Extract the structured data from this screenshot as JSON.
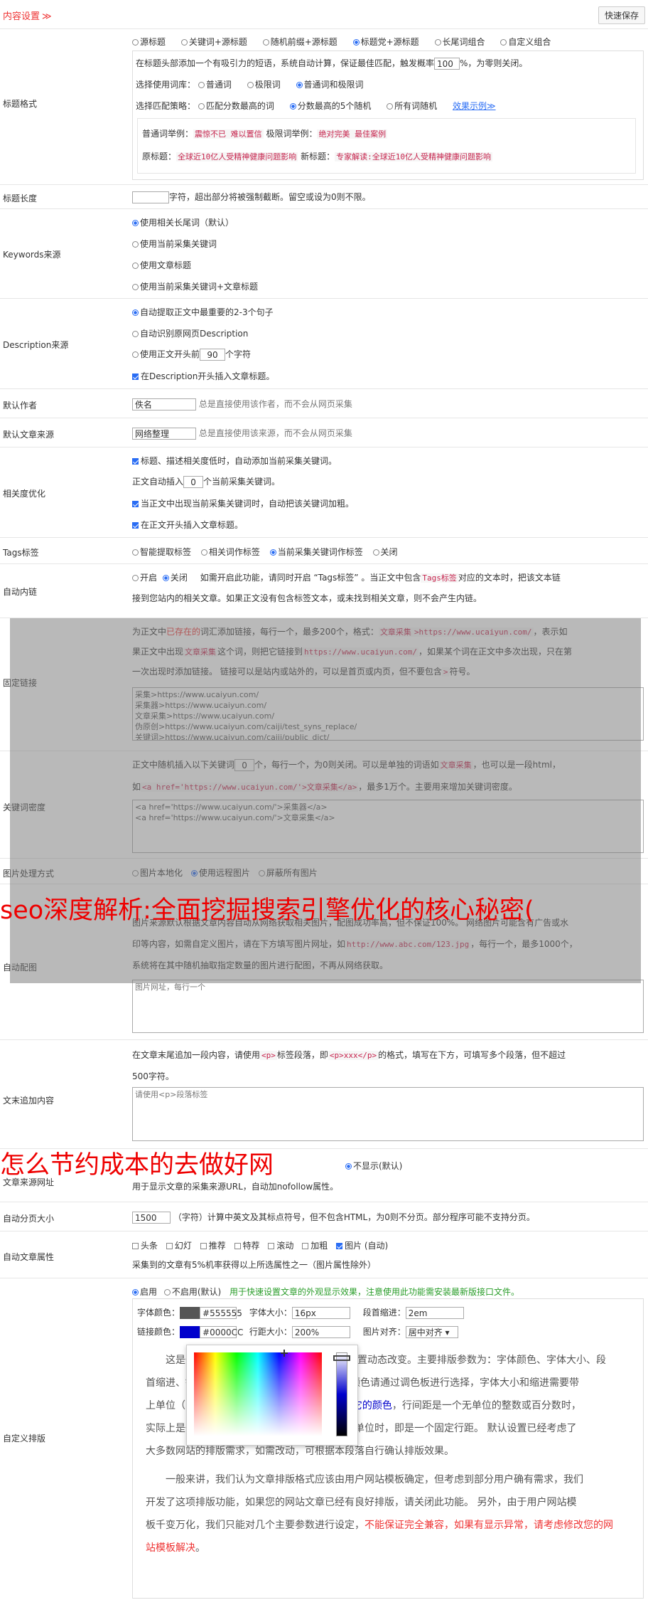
{
  "header": {
    "title": "内容设置",
    "chev": "≫",
    "save_label": "快速保存"
  },
  "rows": {
    "title_format": {
      "label": "标题格式",
      "modes": [
        "源标题",
        "关键词+源标题",
        "随机前缀+源标题",
        "标题党+源标题",
        "长尾词组合",
        "自定义组合"
      ],
      "desc_pre": "在标题头部添加一个有吸引力的短语，系统自动计算，保证最佳匹配，触发概率",
      "prob": "100",
      "desc_post": "%，为零则关闭。",
      "lib_label": "选择使用词库：",
      "libs": [
        "普通词",
        "极限词",
        "普通词和极限词"
      ],
      "strat_label": "选择匹配策略：",
      "strats": [
        "匹配分数最高的词",
        "分数最高的5个随机",
        "所有词随机"
      ],
      "effect_link": "效果示例≫",
      "ex_normal_label": "普通词举例：",
      "ex_normal": "震惊不已 难以置信",
      "ex_limit_label": "极限词举例：",
      "ex_limit": "绝对完美 最佳案例",
      "ex_src_label": "原标题：",
      "ex_src": "全球近10亿人受精神健康问题影响",
      "ex_new_label": "新标题：",
      "ex_new": "专家解读:全球近10亿人受精神健康问题影响"
    },
    "title_len": {
      "label": "标题长度",
      "suffix": "字符，超出部分将被强制截断。留空或设为0则不限。"
    },
    "keywords": {
      "label": "Keywords来源",
      "opts": [
        "使用相关长尾词（默认）",
        "使用当前采集关键词",
        "使用文章标题",
        "使用当前采集关键词+文章标题"
      ]
    },
    "description": {
      "label": "Description来源",
      "opt1": "自动提取正文中最重要的2-3个句子",
      "opt2": "自动识别原网页Description",
      "opt3_pre": "使用正文开头前",
      "opt3_val": "90",
      "opt3_post": "个字符",
      "chk": "在Description开头插入文章标题。"
    },
    "author": {
      "label": "默认作者",
      "value": "佚名",
      "hint": "总是直接使用该作者，而不会从网页采集"
    },
    "source": {
      "label": "默认文章来源",
      "value": "网络整理",
      "hint": "总是直接使用该来源，而不会从网页采集"
    },
    "relevance": {
      "label": "相关度优化",
      "c1": "标题、描述相关度低时，自动添加当前采集关键词。",
      "c2_pre": "正文自动插入",
      "c2_val": "0",
      "c2_post": "个当前采集关键词。",
      "c3": "当正文中出现当前采集关键词时，自动把该关键词加粗。",
      "c4": "在正文开头插入文章标题。"
    },
    "tags": {
      "label": "Tags标签",
      "opts": [
        "智能提取标签",
        "相关词作标签",
        "当前采集关键词作标签",
        "关闭"
      ]
    },
    "autolink": {
      "label": "自动内链",
      "on": "开启",
      "off": "关闭",
      "l1_pre": "如需开启此功能，请同时开启 “Tags标签” 。当正文中包含",
      "l1_code": "Tags标签",
      "l1_post": "对应的文本时，把该文本链",
      "l2": "接到您站内的相关文章。如果正文没有包含标签文本，或未找到相关文章，则不会产生内链。"
    },
    "fixlink": {
      "label": "固定链接",
      "l1_a": "为正文中",
      "l1_b": "已存在的",
      "l1_c": "词汇添加链接，每行一个，最多200个，格式：",
      "l1_code1": "文章采集",
      "l1_code2": ">https://www.ucaiyun.com/",
      "l1_d": "，表示如",
      "l2_a": "果正文中出现",
      "l2_code1": "文章采集",
      "l2_b": "这个词，则把它链接到",
      "l2_code2": "https://www.ucaiyun.com/",
      "l2_c": "，如果某个词在正文中多次出现，只在第",
      "l3": "一次出现时添加链接。 链接可以是站内或站外的，可以是首页或内页，但不要包含",
      "l3_code": ">",
      "l3_post": "符号。",
      "box": [
        "采集>https://www.ucaiyun.com/",
        "采集器>https://www.ucaiyun.com/",
        "文章采集>https://www.ucaiyun.com/",
        "伪原创>https://www.ucaiyun.com/caiji/test_syns_replace/",
        "关键词>https://www.ucaiyun.com/caiji/public_dict/"
      ]
    },
    "density": {
      "label": "关键词密度",
      "l1_pre": "正文中随机插入以下关键词",
      "l1_val": "0",
      "l1_mid": "个，每行一个，为0则关闭。可以是单独的词语如",
      "l1_code": "文章采集",
      "l1_post": "，也可以是一段html，",
      "l2_pre": "如",
      "l2_code": "<a href='https://www.ucaiyun.com/'>文章采集</a>",
      "l2_post": "，最多1万个。主要用来增加关键词密度。",
      "box": [
        "<a href='https://www.ucaiyun.com/'>采集器</a>",
        "<a href='https://www.ucaiyun.com/'>文章采集</a>"
      ]
    },
    "image": {
      "label": "图片处理方式",
      "opts": [
        "图片本地化",
        "使用远程图片",
        "屏蔽所有图片"
      ]
    },
    "autoimg": {
      "label": "自动配图",
      "l1": "图片来源默认根据文章内容自动从网络获取相关图片，配图成功率高，但不保证100%。 网络图片可能含有广告或水",
      "l2_pre": "印等内容，如需自定义图片，请在下方填写图片网址，如",
      "l2_code": "http://www.abc.com/123.jpg",
      "l2_post": "，每行一个，最多1000个，",
      "l3": "系统将在其中随机抽取指定数量的图片进行配图，不再从网络获取。",
      "placeholder": "图片网址，每行一个"
    },
    "tail": {
      "label": "文末追加内容",
      "l1_pre": "在文章末尾追加一段内容，请使用",
      "l1_code1": "<p>",
      "l1_mid": "标签段落，即",
      "l1_code2": "<p>xxx</p>",
      "l1_post": "的格式，填写在下方，可填写多个段落，但不超过",
      "l2": "500字符。",
      "placeholder": "请使用<p>段落标签"
    },
    "srcurl": {
      "label": "文章来源网址",
      "opt_hidden": "不显示(默认)",
      "hint": "用于显示文章的采集来源URL，自动加nofollow属性。"
    },
    "paging": {
      "label": "自动分页大小",
      "value": "1500",
      "hint": "（字符）计算中英文及其标点符号，但不包含HTML，为0则不分页。部分程序可能不支持分页。"
    },
    "attrs": {
      "label": "自动文章属性",
      "opts": [
        "头条",
        "幻灯",
        "推荐",
        "特荐",
        "滚动",
        "加粗",
        "图片 (自动)"
      ],
      "hint": "采集到的文章有5%机率获得以上所选属性之一（图片属性除外）"
    },
    "typeset": {
      "label": "自定义排版",
      "on": "启用",
      "off": "不启用(默认)",
      "green": "用于快速设置文章的外观显示效果，注意使用此功能需安装最新版接口文件。",
      "font_color_label": "字体颜色：",
      "font_color": "#555555",
      "font_size_label": "字体大小：",
      "font_size": "16px",
      "indent_label": "段首缩进：",
      "indent": "2em",
      "link_color_label": "链接颜色：",
      "link_color": "#0000CC",
      "line_h_label": "行距大小：",
      "line_h": "200%",
      "align_label": "图片对齐：",
      "align": "居中对齐",
      "p1_a": "这是一",
      "p1_b": "置动态改变。主要排版参数为：字体颜色、字体大小、段",
      "p1_c": "首缩进、链",
      "p1_d": "颜色请通过调色板进行选择，字体大小和缩进需要带",
      "p1_e": "上单位（p",
      "p1_f": "意它的颜色",
      "p1_g": "，行间距是一个无单位的整数或百分数时，",
      "p1_h": "实际上是一个以字体大小为基数的行距倍数；有单位时，即是一个固定行距。 默认设置已经考虑了",
      "p1_i": "大多数网站的排版需求，如需改动，可根据本段落自行确认排版效果。",
      "p2_a": "一般来讲，我们认为文章排版格式应该由用户网站模板确定，但考虑到部分用户确有需求，我们",
      "p2_b": "开发了这项排版功能，如果您的网站文章已经有良好排版，请关闭此功能。 另外，由于用户网站模",
      "p2_c": "板千变万化，我们只能对几个主要参数进行设定，",
      "p2_red": "不能保证完全兼容，如果有显示异常，请考虑修改您的网",
      "p2_red2": "站模板解决",
      "p2_end": "。"
    }
  },
  "overlays": {
    "big1": "seo深度解析:全面挖掘搜索引擎优化的核心秘密(",
    "big2": "怎么节约成本的去做好网"
  }
}
